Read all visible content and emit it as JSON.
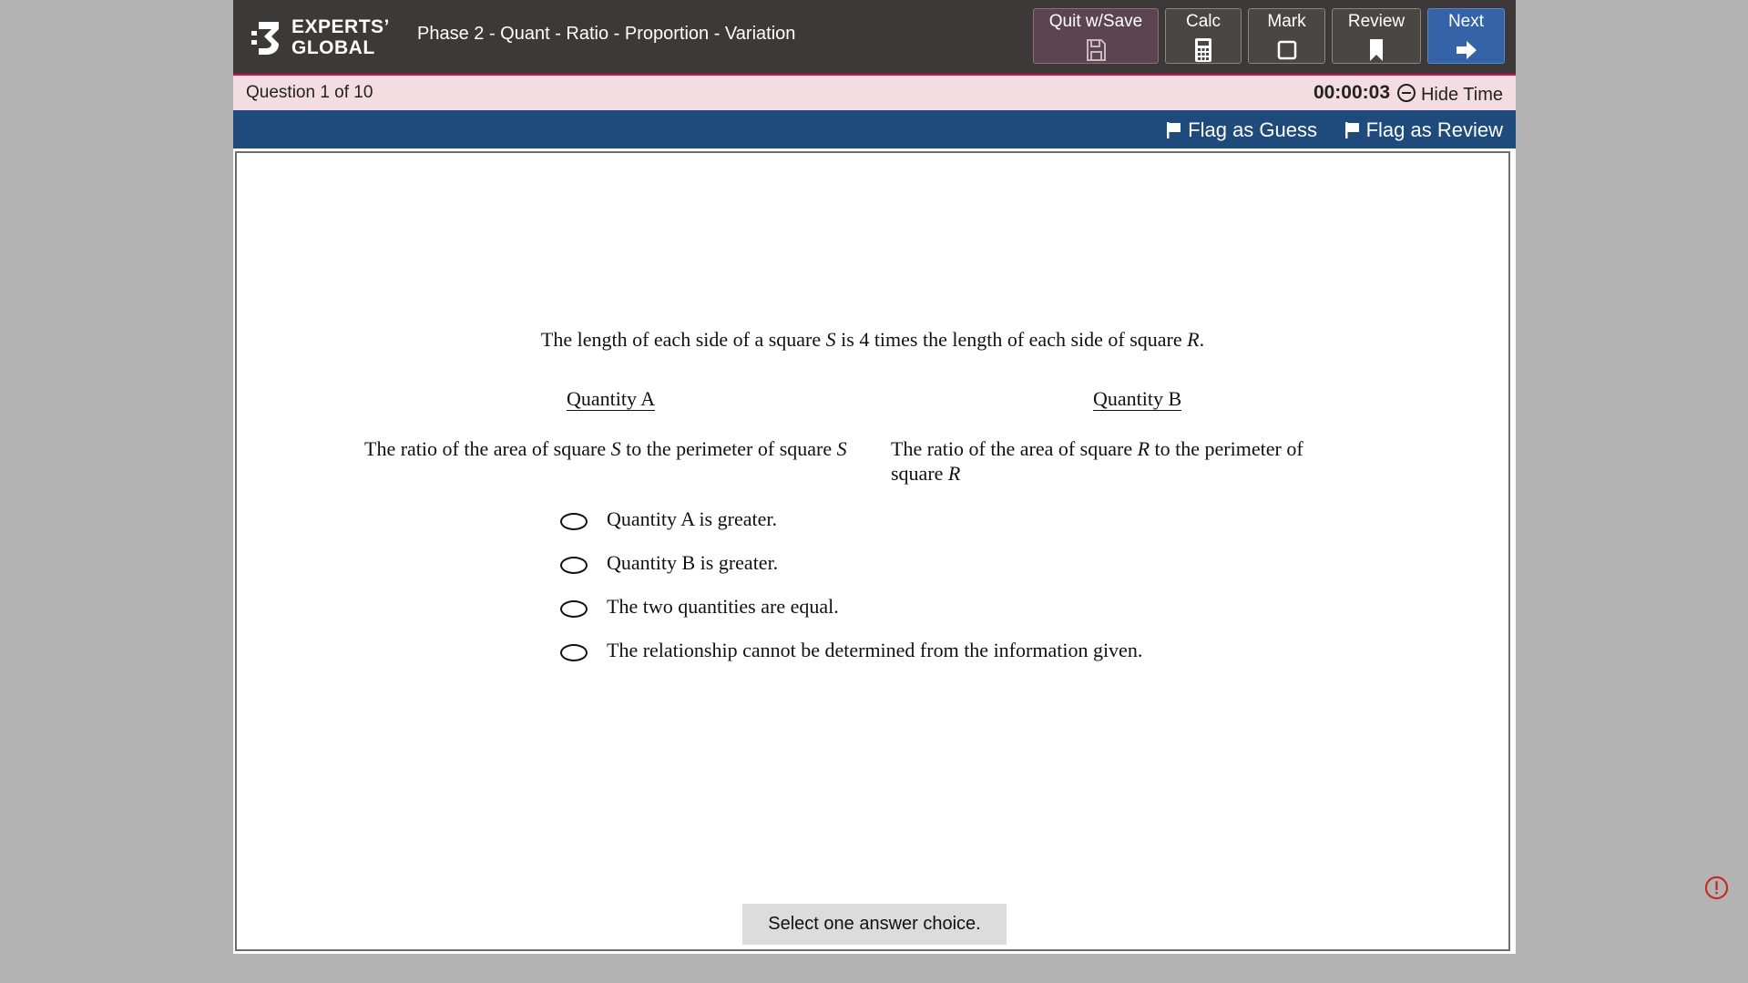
{
  "header": {
    "logo_line1": "EXPERTS’",
    "logo_line2": "GLOBAL",
    "title": "Phase 2 - Quant - Ratio - Proportion - Variation",
    "buttons": {
      "quit": "Quit w/Save",
      "calc": "Calc",
      "mark": "Mark",
      "review": "Review",
      "next": "Next"
    }
  },
  "status": {
    "question_counter": "Question 1 of 10",
    "timer": "00:00:03",
    "hide_time": "Hide Time"
  },
  "flags": {
    "guess": "Flag as Guess",
    "review": "Flag as Review"
  },
  "question": {
    "stem_html": "The length of each side of a square <i>S</i> is 4 times the length of each side of square <i>R</i>.",
    "quantity_a_label": "Quantity A",
    "quantity_b_label": "Quantity B",
    "quantity_a_html": "The ratio of the area of square <i>S</i> to the perimeter of square <i>S</i>",
    "quantity_b_html": "The ratio of the area of square <i>R</i> to the perimeter of square <i>R</i>",
    "choices": [
      "Quantity A is greater.",
      "Quantity B is greater.",
      "The two quantities are equal.",
      "The relationship cannot be determined from the information given."
    ],
    "instruction": "Select one answer choice."
  },
  "colors": {
    "header_bg": "#3d3939",
    "status_bg": "#f3dde3",
    "flagbar_bg": "#1f4a7c",
    "next_bg": "#3563a8",
    "quit_bg": "#5c4550",
    "page_bg": "#b3b3b3",
    "alert": "#c62828"
  },
  "icons": {
    "quit": "save-icon",
    "calc": "calculator-icon",
    "mark": "checkbox-icon",
    "review": "bookmark-icon",
    "next": "arrow-right-icon",
    "flag": "flag-icon",
    "alert": "alert-circle-icon"
  }
}
